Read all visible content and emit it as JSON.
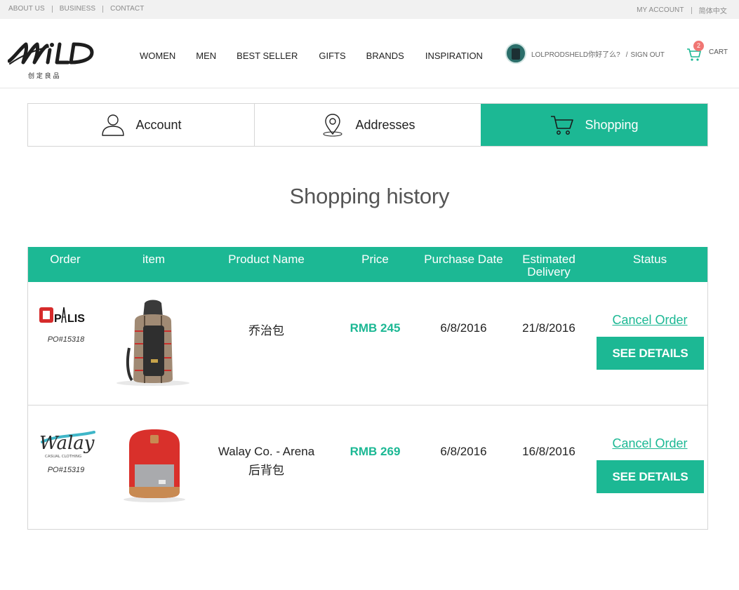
{
  "topbar": {
    "about": "ABOUT US",
    "business": "BUSINESS",
    "contact": "CONTACT",
    "my_account": "MY ACCOUNT",
    "language": "简体中文"
  },
  "header": {
    "logo_sub": "创 定 良 品",
    "nav": [
      "WOMEN",
      "MEN",
      "BEST SELLER",
      "GIFTS",
      "BRANDS",
      "INSPIRATION"
    ],
    "greeting": "LOLPRODSHELD你好了么?",
    "sign_out": "SIGN OUT",
    "cart_label": "CART",
    "cart_count": "2"
  },
  "tabs": [
    {
      "label": "Account",
      "icon": "user-icon",
      "active": false
    },
    {
      "label": "Addresses",
      "icon": "location-pin-icon",
      "active": false
    },
    {
      "label": "Shopping",
      "icon": "cart-icon",
      "active": true
    }
  ],
  "page_title": "Shopping history",
  "table": {
    "headers": {
      "order": "Order",
      "item": "item",
      "product_name": "Product Name",
      "price": "Price",
      "purchase_date": "Purchase Date",
      "estimated_delivery_1": "Estimated",
      "estimated_delivery_2": "Delivery",
      "status": "Status"
    },
    "rows": [
      {
        "brand": "OPALIS",
        "po": "PO#15318",
        "product_name_1": "乔治包",
        "product_name_2": "",
        "price": "RMB 245",
        "purchase_date": "6/8/2016",
        "delivery": "21/8/2016",
        "cancel": "Cancel Order",
        "details": "SEE DETAILS"
      },
      {
        "brand": "Walay",
        "brand_tag": "CASUAL CLOTHING",
        "po": "PO#15319",
        "product_name_1": "Walay Co. - Arena",
        "product_name_2": "后背包",
        "price": "RMB 269",
        "purchase_date": "6/8/2016",
        "delivery": "16/8/2016",
        "cancel": "Cancel Order",
        "details": "SEE DETAILS"
      }
    ]
  },
  "colors": {
    "accent": "#1cb894",
    "badge": "#f07673",
    "brand_red": "#d62b2b",
    "walay_teal": "#3fb6c8"
  }
}
